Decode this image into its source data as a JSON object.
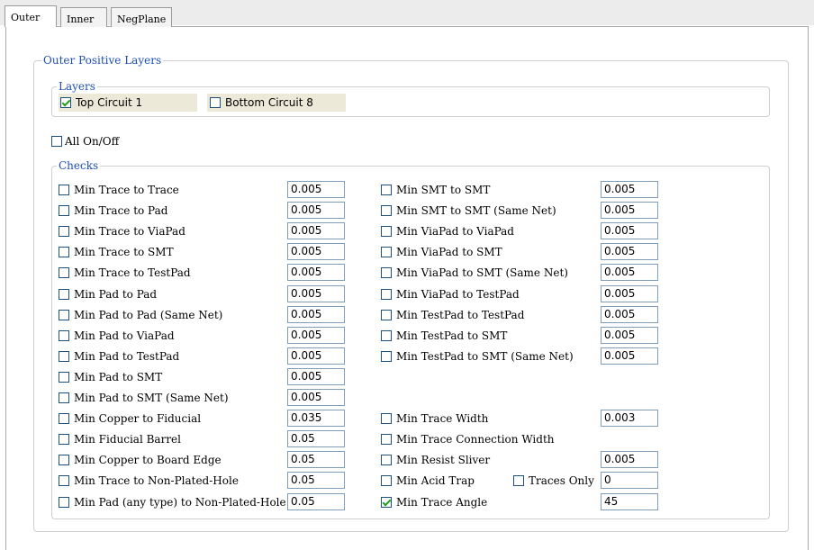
{
  "tabs": [
    "Outer",
    "Inner",
    "NegPlane"
  ],
  "outer_group": {
    "title": "Outer Positive Layers"
  },
  "layers_group": {
    "title": "Layers",
    "items": [
      {
        "label": "Top Circuit 1",
        "checked": true
      },
      {
        "label": "Bottom Circuit 8",
        "checked": false
      }
    ]
  },
  "all_onoff": {
    "label": "All On/Off",
    "checked": false
  },
  "checks_group": {
    "title": "Checks",
    "left": [
      {
        "label": "Min Trace to Trace",
        "value": "0.005",
        "checked": false
      },
      {
        "label": "Min Trace to Pad",
        "value": "0.005",
        "checked": false
      },
      {
        "label": "Min Trace to ViaPad",
        "value": "0.005",
        "checked": false
      },
      {
        "label": "Min Trace to SMT",
        "value": "0.005",
        "checked": false
      },
      {
        "label": "Min Trace to TestPad",
        "value": "0.005",
        "checked": false
      },
      {
        "label": "Min Pad to Pad",
        "value": "0.005",
        "checked": false
      },
      {
        "label": "Min Pad to Pad (Same Net)",
        "value": "0.005",
        "checked": false
      },
      {
        "label": "Min Pad to ViaPad",
        "value": "0.005",
        "checked": false
      },
      {
        "label": "Min Pad to TestPad",
        "value": "0.005",
        "checked": false
      },
      {
        "label": "Min Pad to SMT",
        "value": "0.005",
        "checked": false
      },
      {
        "label": "Min Pad to SMT (Same Net)",
        "value": "0.005",
        "checked": false
      },
      {
        "label": "Min Copper to Fiducial",
        "value": "0.035",
        "checked": false
      },
      {
        "label": "Min Fiducial Barrel",
        "value": "0.05",
        "checked": false
      },
      {
        "label": "Min Copper to Board Edge",
        "value": "0.05",
        "checked": false
      },
      {
        "label": "Min Trace to Non-Plated-Hole",
        "value": "0.05",
        "checked": false
      },
      {
        "label": "Min Pad (any type) to Non-Plated-Hole",
        "value": "0.05",
        "checked": false
      }
    ],
    "right_top": [
      {
        "label": "Min SMT to SMT",
        "value": "0.005",
        "checked": false
      },
      {
        "label": "Min SMT to SMT (Same Net)",
        "value": "0.005",
        "checked": false
      },
      {
        "label": "Min ViaPad to ViaPad",
        "value": "0.005",
        "checked": false
      },
      {
        "label": "Min ViaPad to SMT",
        "value": "0.005",
        "checked": false
      },
      {
        "label": "Min ViaPad to SMT (Same Net)",
        "value": "0.005",
        "checked": false
      },
      {
        "label": "Min ViaPad to TestPad",
        "value": "0.005",
        "checked": false
      },
      {
        "label": "Min TestPad to TestPad",
        "value": "0.005",
        "checked": false
      },
      {
        "label": "Min TestPad to SMT",
        "value": "0.005",
        "checked": false
      },
      {
        "label": "Min TestPad to SMT (Same Net)",
        "value": "0.005",
        "checked": false
      }
    ],
    "right_bottom": [
      {
        "label": "Min Trace Width",
        "value": "0.003",
        "checked": false
      },
      {
        "label": "Min Trace Connection Width",
        "value": null,
        "checked": false
      },
      {
        "label": "Min Resist Sliver",
        "value": "0.005",
        "checked": false
      },
      {
        "label": "Min Acid Trap",
        "value": "0",
        "checked": false,
        "extra": {
          "label": "Traces Only",
          "checked": false
        }
      },
      {
        "label": "Min Trace Angle",
        "value": "45",
        "checked": true
      }
    ]
  }
}
